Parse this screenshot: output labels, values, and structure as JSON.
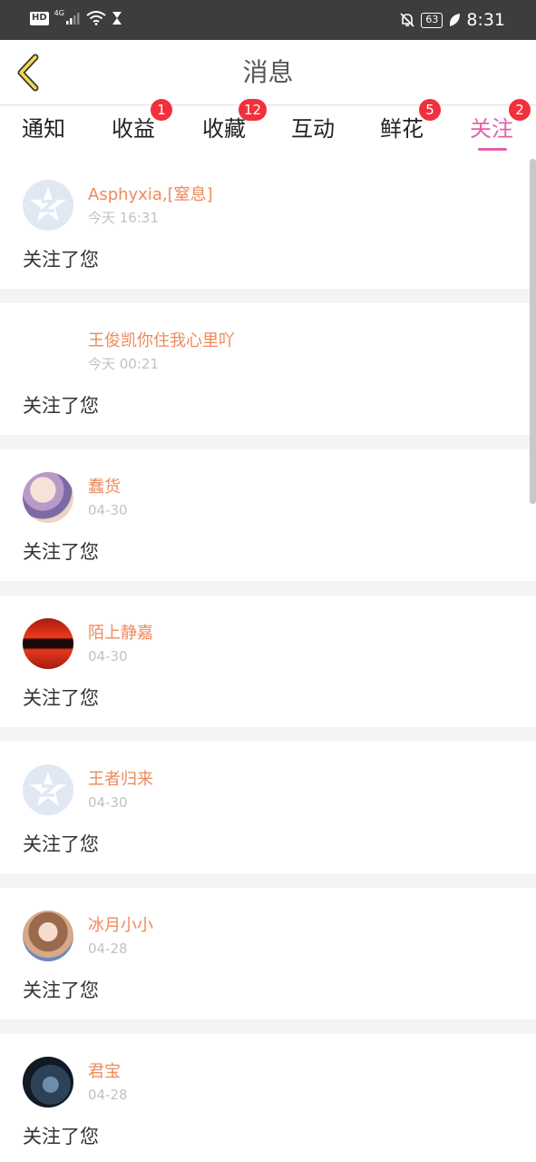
{
  "status_bar": {
    "hd": "HD",
    "network": "4G",
    "battery": "63",
    "time": "8:31"
  },
  "header": {
    "title": "消息",
    "back_icon": "chevron-left-icon"
  },
  "tabs": [
    {
      "label": "通知",
      "badge": ""
    },
    {
      "label": "收益",
      "badge": "1"
    },
    {
      "label": "收藏",
      "badge": "12"
    },
    {
      "label": "互动",
      "badge": ""
    },
    {
      "label": "鲜花",
      "badge": "5"
    },
    {
      "label": "关注",
      "badge": "2",
      "active": true
    }
  ],
  "notifications": [
    {
      "username": "Asphyxia,[窒息]",
      "time": "今天 16:31",
      "message": "关注了您",
      "avatar": "default-avatar-icon"
    },
    {
      "username": "王俊凯你住我心里吖",
      "time": "今天 00:21",
      "message": "关注了您",
      "avatar": "none"
    },
    {
      "username": "蠢货",
      "time": "04-30",
      "message": "关注了您",
      "avatar": "anime-girl-avatar"
    },
    {
      "username": "陌上静嘉",
      "time": "04-30",
      "message": "关注了您",
      "avatar": "sunset-avatar"
    },
    {
      "username": "王者归来",
      "time": "04-30",
      "message": "关注了您",
      "avatar": "default-avatar-icon"
    },
    {
      "username": "冰月小小",
      "time": "04-28",
      "message": "关注了您",
      "avatar": "anime-girl-avatar"
    },
    {
      "username": "君宝",
      "time": "04-28",
      "message": "关注了您",
      "avatar": "dark-photo-avatar"
    }
  ],
  "colors": {
    "accent": "#e462a8",
    "badge": "#f2303c",
    "username": "#ee8a5c",
    "status_bar": "#3d3d3d"
  }
}
